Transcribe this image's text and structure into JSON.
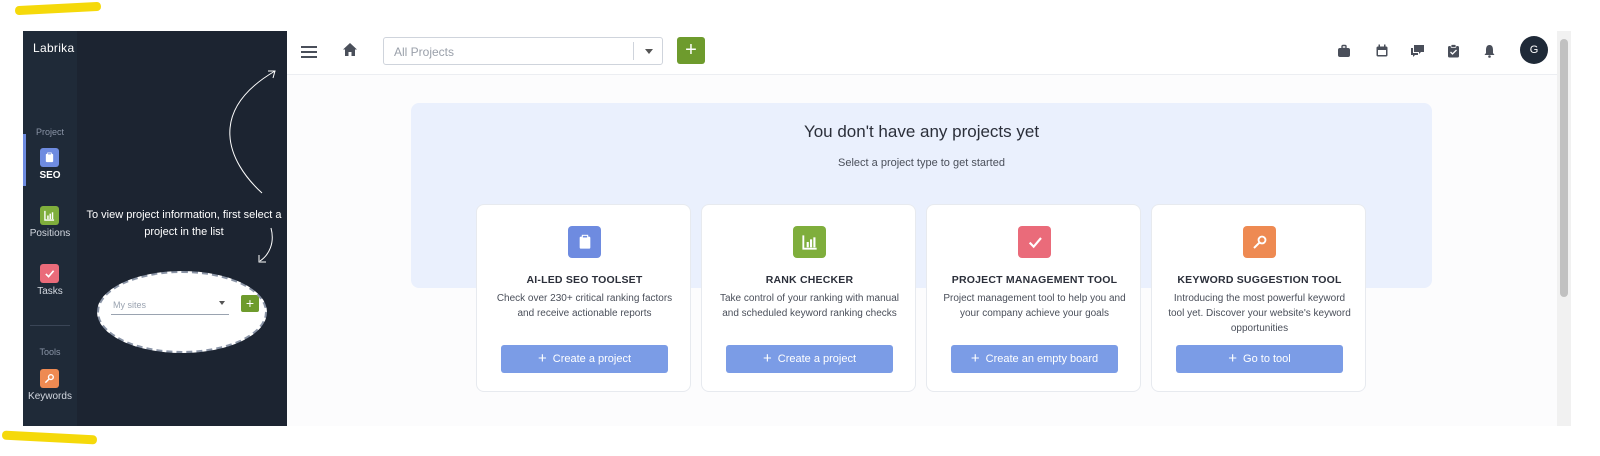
{
  "app": {
    "logo": "Labrika"
  },
  "rail": {
    "section_project": "Project",
    "section_tools": "Tools",
    "items": [
      {
        "label": "SEO",
        "icon": "clipboard-icon",
        "color": "#6e8be0",
        "active": true
      },
      {
        "label": "Positions",
        "icon": "chart-icon",
        "color": "#7fae3c",
        "active": false
      },
      {
        "label": "Tasks",
        "icon": "check-icon",
        "color": "#ea6b7a",
        "active": false
      },
      {
        "label": "Keywords",
        "icon": "key-icon",
        "color": "#ee8a52",
        "active": false
      }
    ]
  },
  "tip": {
    "text": "To view project information, first select a project in the list",
    "select_value": "My sites",
    "add_label": "+"
  },
  "topbar": {
    "project_select_placeholder": "All Projects",
    "add_label": "+",
    "avatar": "G"
  },
  "main": {
    "title": "You don't have any projects yet",
    "subtitle": "Select a project type to get started",
    "cards": [
      {
        "title": "AI-LED SEO TOOLSET",
        "desc": "Check over 230+ critical ranking factors and receive actionable reports",
        "button": "Create a project",
        "icon": "clipboard-icon",
        "color": "#6e8be0"
      },
      {
        "title": "RANK CHECKER",
        "desc": "Take control of your ranking with manual and scheduled keyword ranking checks",
        "button": "Create a project",
        "icon": "chart-icon",
        "color": "#7fae3c"
      },
      {
        "title": "PROJECT MANAGEMENT TOOL",
        "desc": "Project management tool to help you and your company achieve your goals",
        "button": "Create an empty board",
        "icon": "check-icon",
        "color": "#ea6b7a"
      },
      {
        "title": "KEYWORD SUGGESTION TOOL",
        "desc": "Introducing the most powerful keyword tool yet. Discover your website's keyword opportunities",
        "button": "Go to tool",
        "icon": "key-icon",
        "color": "#ee8a52"
      }
    ]
  },
  "colors": {
    "accent_green": "#6e9b2d",
    "button_blue": "#7b9ce6",
    "sidebar_dark": "#1f2a38",
    "hero_bg": "#eaf0fd"
  }
}
